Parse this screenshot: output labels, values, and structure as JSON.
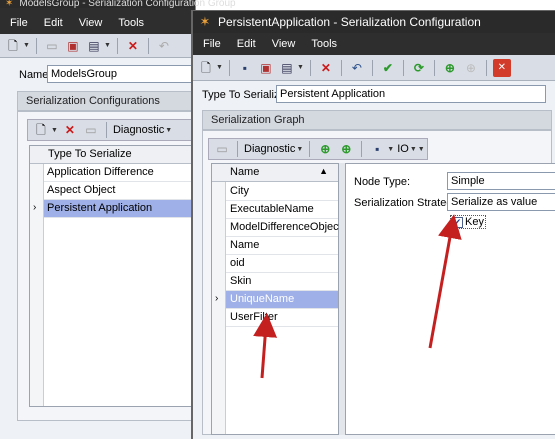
{
  "back_window": {
    "title": "ModelsGroup - Serialization Configuration Group",
    "menu": [
      "File",
      "Edit",
      "View",
      "Tools"
    ],
    "name_label": "Name:",
    "name_value": "ModelsGroup",
    "group_title": "Serialization Configurations",
    "toolbar_diagnostic": "Diagnostic",
    "column_header": "Type To Serialize",
    "rows": [
      "Application Difference",
      "Aspect Object",
      "Persistent Application"
    ],
    "selected_row": 2
  },
  "front_window": {
    "title": "PersistentApplication - Serialization Configuration",
    "menu": [
      "File",
      "Edit",
      "View",
      "Tools"
    ],
    "type_label": "Type To Serialize:",
    "type_value": "Persistent Application",
    "graph_title": "Serialization Graph",
    "toolbar_diagnostic": "Diagnostic",
    "toolbar_io": "IO",
    "list_header": "Name",
    "list_items": [
      "City",
      "ExecutableName",
      "ModelDifferenceObjects",
      "Name",
      "oid",
      "Skin",
      "UniqueName",
      "UserFilter"
    ],
    "selected_item": 6,
    "node_type_label": "Node Type:",
    "node_type_value": "Simple",
    "strategy_label": "Serialization Strategy:",
    "strategy_value": "Serialize as value",
    "key_label": "Key",
    "key_checked": true
  },
  "colors": {
    "title_bg": "#2b2b2b",
    "selection": "#9fb0e8",
    "arrow": "#c42020"
  }
}
